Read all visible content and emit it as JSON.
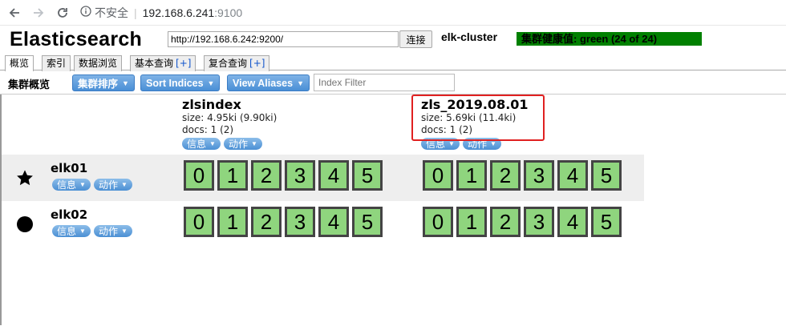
{
  "browser": {
    "insecure_label": "不安全",
    "host": "192.168.6.241",
    "port": ":9100"
  },
  "header": {
    "logo": "Elasticsearch",
    "url_value": "http://192.168.6.242:9200/",
    "connect_label": "连接",
    "cluster_name": "elk-cluster",
    "health": "集群健康值: green (24 of 24)",
    "health_color": "#008000"
  },
  "tabs": [
    {
      "label": "概览",
      "plus": ""
    },
    {
      "label": "索引",
      "plus": ""
    },
    {
      "label": "数据浏览",
      "plus": ""
    },
    {
      "label": "基本查询",
      "plus": "[+]"
    },
    {
      "label": "复合查询",
      "plus": "[+]"
    }
  ],
  "toolbar": {
    "title": "集群概览",
    "sort_cluster": "集群排序",
    "sort_indices": "Sort Indices",
    "view_aliases": "View Aliases",
    "filter_placeholder": "Index Filter"
  },
  "indices": [
    {
      "name": "zlsindex",
      "size": "size: 4.95ki (9.90ki)",
      "docs": "docs: 1 (2)",
      "info": "信息",
      "action": "动作"
    },
    {
      "name": "zls_2019.08.01",
      "size": "size: 5.69ki (11.4ki)",
      "docs": "docs: 1 (2)",
      "info": "信息",
      "action": "动作"
    }
  ],
  "nodes": [
    {
      "name": "elk01",
      "icon": "star-icon",
      "info": "信息",
      "action": "动作"
    },
    {
      "name": "elk02",
      "icon": "circle-icon",
      "info": "信息",
      "action": "动作"
    }
  ],
  "shards": [
    "0",
    "1",
    "2",
    "3",
    "4",
    "5"
  ],
  "colors": {
    "shard_fill": "#8fd57e",
    "highlight": "#e02020",
    "button": "#4a8fd6"
  }
}
